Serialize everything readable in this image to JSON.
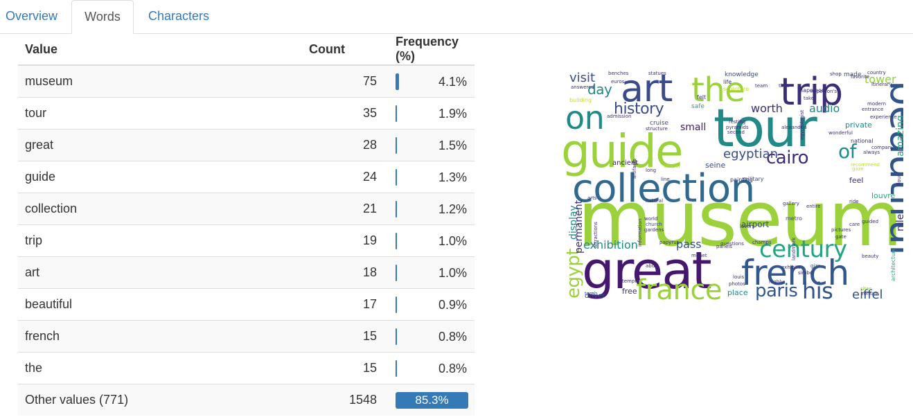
{
  "tabs": [
    {
      "label": "Overview",
      "active": false
    },
    {
      "label": "Words",
      "active": true
    },
    {
      "label": "Characters",
      "active": false
    }
  ],
  "table": {
    "headers": {
      "value": "Value",
      "count": "Count",
      "frequency": "Frequency (%)"
    },
    "rows": [
      {
        "value": "museum",
        "count": "75",
        "pct": "4.1%",
        "frac": 0.041
      },
      {
        "value": "tour",
        "count": "35",
        "pct": "1.9%",
        "frac": 0.019
      },
      {
        "value": "great",
        "count": "28",
        "pct": "1.5%",
        "frac": 0.015
      },
      {
        "value": "guide",
        "count": "24",
        "pct": "1.3%",
        "frac": 0.013
      },
      {
        "value": "collection",
        "count": "21",
        "pct": "1.2%",
        "frac": 0.012
      },
      {
        "value": "trip",
        "count": "19",
        "pct": "1.0%",
        "frac": 0.01
      },
      {
        "value": "art",
        "count": "18",
        "pct": "1.0%",
        "frac": 0.01
      },
      {
        "value": "beautiful",
        "count": "17",
        "pct": "0.9%",
        "frac": 0.009
      },
      {
        "value": "french",
        "count": "15",
        "pct": "0.8%",
        "frac": 0.008
      },
      {
        "value": "the",
        "count": "15",
        "pct": "0.8%",
        "frac": 0.008
      }
    ],
    "other": {
      "value": "Other values (771)",
      "count": "1548",
      "pct": "85.3%",
      "frac": 0.853
    }
  },
  "colors": {
    "accent": "#337ab7",
    "border": "#dddddd",
    "stripe": "#f9f9f9",
    "link": "#337ab7"
  },
  "wordcloud": {
    "words": [
      "museum",
      "tour",
      "great",
      "guide",
      "collection",
      "trip",
      "art",
      "beautiful",
      "french",
      "the",
      "on",
      "france",
      "century",
      "paris",
      "his",
      "egypt",
      "cairo",
      "history",
      "day",
      "visit",
      "eiffel",
      "egyptian",
      "of",
      "worth",
      "audio",
      "pass",
      "exhibition",
      "nile",
      "amazing",
      "tower",
      "display",
      "permanent",
      "small",
      "airport",
      "place",
      "driver",
      "free",
      "louvre",
      "seine",
      "ancient",
      "private",
      "feel",
      "national",
      "military",
      "gardens",
      "church",
      "world",
      "tomb",
      "metro",
      "entire",
      "napoleon",
      "sculpture",
      "knowledge",
      "made",
      "country",
      "cruise",
      "structure",
      "wonderful",
      "experience",
      "second",
      "admission",
      "safe",
      "felt",
      "life",
      "pictures",
      "photos",
      "roman",
      "sites",
      "highly",
      "gate",
      "giza",
      "temple",
      "abu",
      "simbel",
      "papyrus",
      "monet",
      "questions",
      "painting",
      "itinerary",
      "modern",
      "entrance",
      "line",
      "long",
      "chapel",
      "natural",
      "arts",
      "guided",
      "architecture",
      "beauty",
      "care",
      "ride",
      "answered",
      "building",
      "euros",
      "benches",
      "statues",
      "team",
      "time",
      "take",
      "lovers",
      "alexandria",
      "resting",
      "pyramids",
      "artifacts",
      "information",
      "attractions",
      "landmark",
      "gallery",
      "exhibits",
      "champs",
      "napoleon's",
      "egyptologist",
      "recommend",
      "gaze",
      "company",
      "always",
      "favorite",
      "shop",
      "panels",
      "louis",
      "flour"
    ]
  }
}
